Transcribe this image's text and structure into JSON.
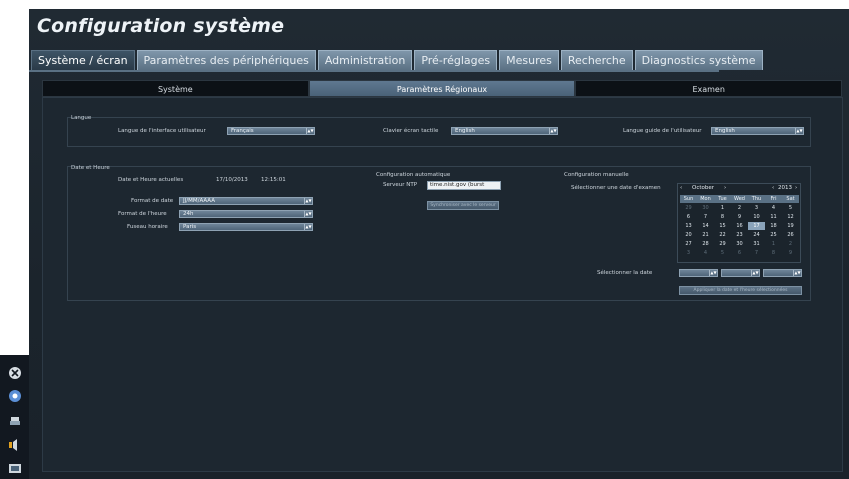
{
  "title": "Configuration système",
  "tabs": [
    "Système / écran",
    "Paramètres des périphériques",
    "Administration",
    "Pré-réglages",
    "Mesures",
    "Recherche",
    "Diagnostics système"
  ],
  "subtabs": [
    "Système",
    "Paramètres Régionaux",
    "Examen"
  ],
  "langue": {
    "section_label": "Langue",
    "ui_label": "Langue de l'interface utilisateur",
    "ui_value": "Français",
    "keyboard_label": "Clavier écran tactile",
    "keyboard_value": "English",
    "guide_label": "Langue guide de l'utilisateur",
    "guide_value": "English"
  },
  "datetime": {
    "section_label": "Date et Heure",
    "current_label": "Date et Heure actuelles",
    "current_date": "17/10/2013",
    "current_time": "12:15:01",
    "date_format_label": "Format de date",
    "date_format_value": "JJ/MM/AAAA",
    "time_format_label": "Format de l'heure",
    "time_format_value": "24h",
    "timezone_label": "Fuseau horaire",
    "timezone_value": "Paris"
  },
  "auto_config": {
    "title": "Configuration automatique",
    "ntp_label": "Serveur NTP",
    "ntp_value": "time.nist.gov (burst",
    "button": "Synchroniser avec le serveur"
  },
  "manual_config": {
    "title": "Configuration manuelle",
    "select_exam_date_label": "Sélectionner une date d'examen",
    "calendar_month": "October",
    "calendar_year": "2013",
    "weekdays": [
      "Sun",
      "Mon",
      "Tue",
      "Wed",
      "Thu",
      "Fri",
      "Sat"
    ],
    "days": [
      [
        "29",
        "30",
        "1",
        "2",
        "3",
        "4",
        "5"
      ],
      [
        "6",
        "7",
        "8",
        "9",
        "10",
        "11",
        "12"
      ],
      [
        "13",
        "14",
        "15",
        "16",
        "17",
        "18",
        "19"
      ],
      [
        "20",
        "21",
        "22",
        "23",
        "24",
        "25",
        "26"
      ],
      [
        "27",
        "28",
        "29",
        "30",
        "31",
        "1",
        "2"
      ],
      [
        "3",
        "4",
        "5",
        "6",
        "7",
        "8",
        "9"
      ]
    ],
    "selected_day": "17",
    "select_date_label": "Sélectionner la date",
    "button": "Appliquer la date et l'heure sélectionnées"
  },
  "colors": {
    "accent": "#5f7890",
    "background": "#1d2730",
    "tab": "#6f8599"
  },
  "left_icons": [
    "close-icon",
    "settings-icon",
    "printer-icon",
    "volume-icon",
    "display-icon"
  ]
}
